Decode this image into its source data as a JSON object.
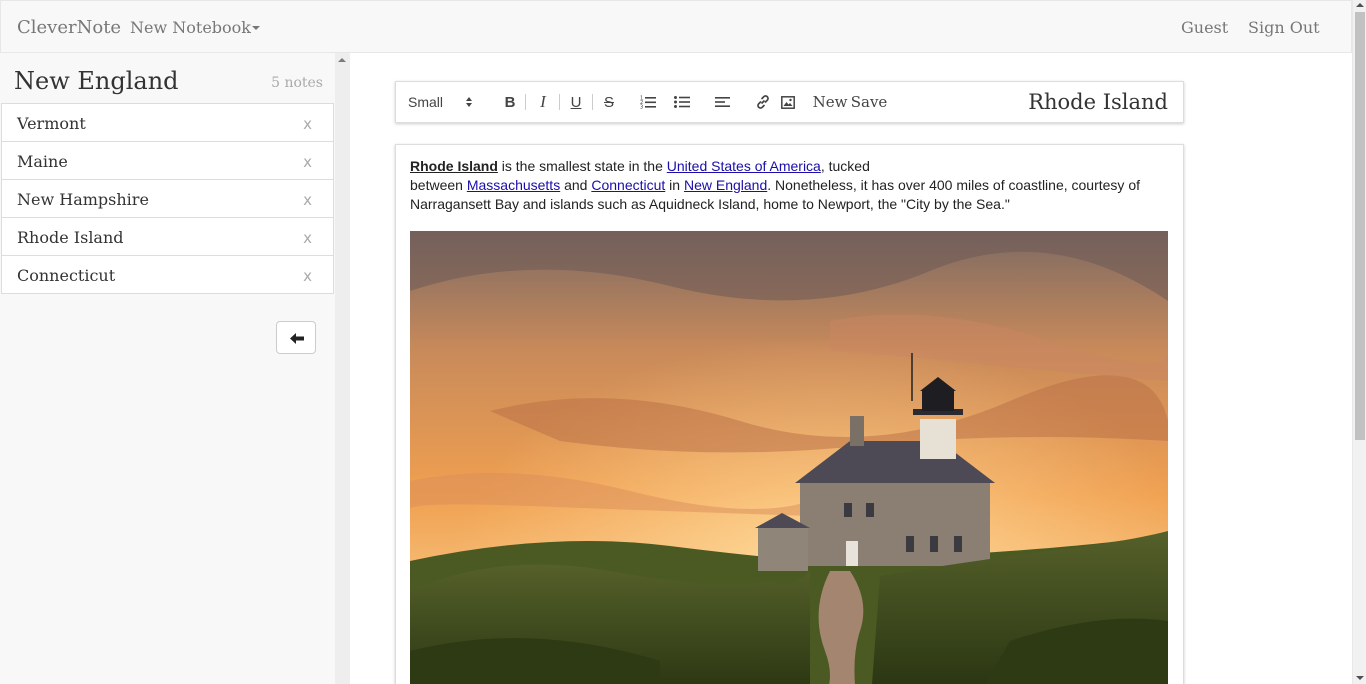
{
  "navbar": {
    "brand": "CleverNote",
    "notebook_menu": "New Notebook",
    "user": "Guest",
    "sign_out": "Sign Out"
  },
  "sidebar": {
    "notebook_title": "New England",
    "note_count": "5 notes",
    "delete_label": "x",
    "notes": [
      {
        "label": "Vermont"
      },
      {
        "label": "Maine"
      },
      {
        "label": "New Hampshire"
      },
      {
        "label": "Rhode Island"
      },
      {
        "label": "Connecticut"
      }
    ]
  },
  "toolbar": {
    "size_selected": "Small",
    "bold": "B",
    "italic": "I",
    "underline": "U",
    "strike": "S",
    "new_label": "New",
    "save_label": "Save",
    "note_title": "Rhode Island",
    "icons": [
      "ordered-list-icon",
      "bullet-list-icon",
      "align-icon",
      "link-icon",
      "image-icon"
    ]
  },
  "note": {
    "bold_title": "Rhode Island",
    "t1": " is the smallest state in the ",
    "link_usa": "United States of America",
    "t2": ", tucked",
    "t3": "between ",
    "link_mass": "Massachusetts",
    "t4": " and ",
    "link_conn": "Connecticut",
    "t5": " in ",
    "link_ne": "New England",
    "t6": ". Nonetheless, it has over 400 miles of coastline, courtesy of Narragansett Bay and islands such as Aquidneck Island, home to Newport, the \"City by the Sea.\""
  },
  "colors": {
    "link": "#1a0dab",
    "navbar_bg": "#f8f8f8",
    "sky_top": "#7d6a63",
    "sky_glow": "#f0a050",
    "grass": "#3f4f22"
  }
}
